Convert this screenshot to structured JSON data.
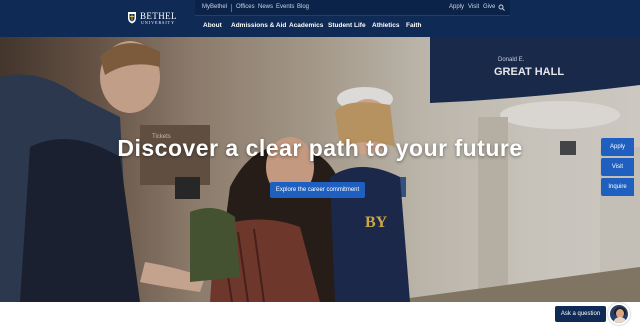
{
  "brand": {
    "name": "BETHEL",
    "subtitle": "UNIVERSITY",
    "logo_icon": "shield-crest-icon"
  },
  "utility_nav": {
    "portal": "MyBethel",
    "links": [
      "Offices",
      "News",
      "Events",
      "Blog"
    ],
    "actions": [
      "Apply",
      "Visit",
      "Give"
    ],
    "search_icon": "search-icon"
  },
  "main_nav": {
    "items": [
      "About",
      "Admissions & Aid",
      "Academics",
      "Student Life",
      "Athletics",
      "Faith"
    ]
  },
  "hero": {
    "headline": "Discover a clear path to your future",
    "cta_label": "Explore the career commitment",
    "sign_line1": "Donald E.",
    "sign_line2": "GREAT HALL",
    "wall_text": "Tickets"
  },
  "side_actions": [
    "Apply",
    "Visit",
    "Inquire"
  ],
  "chat": {
    "label": "Ask a question",
    "avatar_icon": "advisor-avatar"
  },
  "colors": {
    "navy": "#0f2a55",
    "accent_blue": "#1f5fbf",
    "white": "#ffffff"
  }
}
